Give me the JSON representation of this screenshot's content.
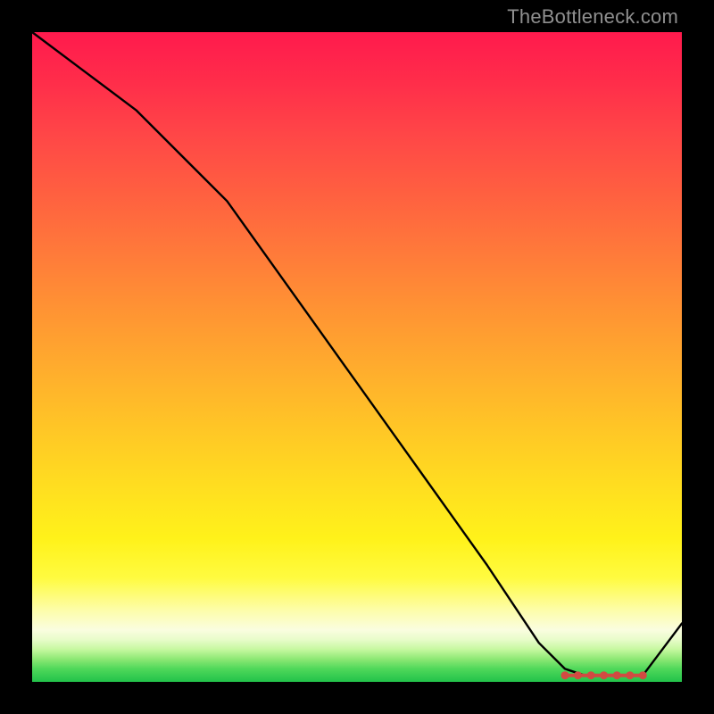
{
  "watermark": "TheBottleneck.com",
  "colors": {
    "background": "#000000",
    "curve": "#000000",
    "markers": "#d24a42"
  },
  "chart_data": {
    "type": "line",
    "title": "",
    "xlabel": "",
    "ylabel": "",
    "xlim": [
      0,
      100
    ],
    "ylim": [
      0,
      100
    ],
    "x": [
      0,
      8,
      16,
      24,
      30,
      40,
      50,
      60,
      70,
      78,
      82,
      85,
      88,
      91,
      94,
      100
    ],
    "values": [
      100,
      94,
      88,
      80,
      74,
      60,
      46,
      32,
      18,
      6,
      2,
      1,
      1,
      1,
      1,
      9
    ],
    "annotations": [
      {
        "type": "flat-segment",
        "x_start": 82,
        "x_end": 94,
        "y": 1
      }
    ]
  }
}
